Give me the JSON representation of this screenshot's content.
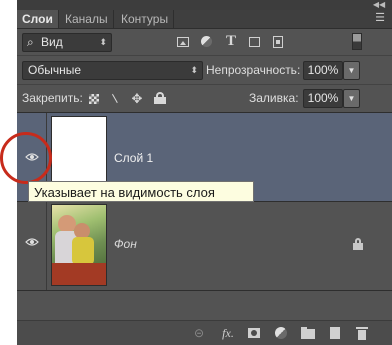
{
  "panel": {
    "collapse_icon": "double-chevron-left-icon",
    "menu_icon": "panel-menu-icon"
  },
  "tabs": [
    {
      "label": "Слои",
      "active": true
    },
    {
      "label": "Каналы",
      "active": false
    },
    {
      "label": "Контуры",
      "active": false
    }
  ],
  "filter": {
    "search_glyph": "⌕",
    "kind_label": "Вид",
    "icons": [
      "pixel-layer-filter-icon",
      "adjustment-layer-filter-icon",
      "type-layer-filter-icon",
      "shape-layer-filter-icon",
      "smart-object-filter-icon"
    ],
    "toggle_icon": "filter-toggle-icon"
  },
  "blend": {
    "mode": "Обычные",
    "opacity_label": "Непрозрачность:",
    "opacity_value": "100%"
  },
  "lock": {
    "label": "Закрепить:",
    "icons": [
      "lock-transparent-pixels-icon",
      "lock-image-pixels-icon",
      "lock-position-icon",
      "lock-all-icon"
    ],
    "fill_label": "Заливка:",
    "fill_value": "100%"
  },
  "layers": [
    {
      "name": "Слой 1",
      "selected": true,
      "thumbnail": "white",
      "visible": true
    },
    {
      "name": "Фон",
      "selected": false,
      "thumbnail": "photo",
      "visible": true,
      "locked": true
    }
  ],
  "tooltip": {
    "text": "Указывает на видимость слоя"
  },
  "annotation": {
    "color": "#c72b1b"
  },
  "colors": {
    "panel_bg": "#535353",
    "selected_layer_bg": "#5a6478",
    "tooltip_bg": "#fdfde0"
  },
  "bottom_bar": {
    "icons": [
      "link-layers-icon",
      "fx-icon",
      "add-mask-icon",
      "adjustment-layer-icon",
      "group-folder-icon",
      "new-layer-icon",
      "trash-icon"
    ]
  }
}
